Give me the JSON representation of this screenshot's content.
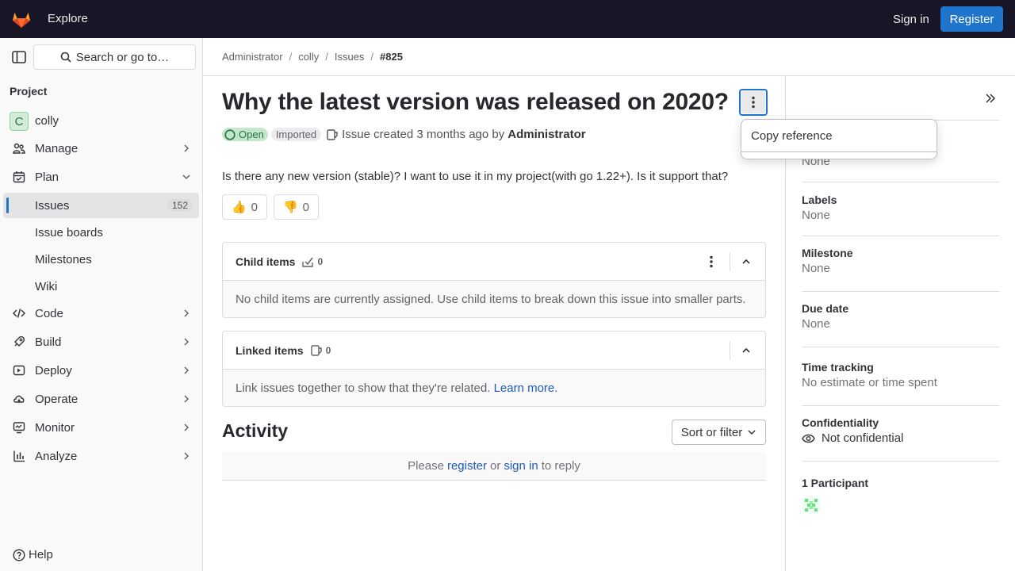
{
  "topbar": {
    "explore": "Explore",
    "sign_in": "Sign in",
    "register": "Register"
  },
  "sidebar": {
    "search": "Search or go to…",
    "section": "Project",
    "project": {
      "initial": "C",
      "name": "colly"
    },
    "items": [
      {
        "label": "Manage",
        "icon": "users-icon"
      },
      {
        "label": "Plan",
        "icon": "plan-icon"
      },
      {
        "label": "Issues",
        "count": "152"
      },
      {
        "label": "Issue boards"
      },
      {
        "label": "Milestones"
      },
      {
        "label": "Wiki"
      },
      {
        "label": "Code",
        "icon": "code-icon"
      },
      {
        "label": "Build",
        "icon": "rocket-icon"
      },
      {
        "label": "Deploy",
        "icon": "deploy-icon"
      },
      {
        "label": "Operate",
        "icon": "cloud-icon"
      },
      {
        "label": "Monitor",
        "icon": "monitor-icon"
      },
      {
        "label": "Analyze",
        "icon": "chart-icon"
      }
    ],
    "help": "Help"
  },
  "breadcrumb": [
    "Administrator",
    "colly",
    "Issues",
    "#825"
  ],
  "issue": {
    "title": "Why the latest version was released on 2020?",
    "status": "Open",
    "imported": "Imported",
    "created": "Issue created 3 months ago by",
    "author": "Administrator",
    "description": "Is there any new version (stable)? I want to use it in my project(with go 1.22+). Is it support that?",
    "thumbs_up": "0",
    "thumbs_down": "0"
  },
  "child_items": {
    "title": "Child items",
    "count": "0",
    "empty": "No child items are currently assigned. Use child items to break down this issue into smaller parts."
  },
  "linked_items": {
    "title": "Linked items",
    "count": "0",
    "text": "Link issues together to show that they're related.",
    "learn_more": "Learn more",
    "period": "."
  },
  "activity": {
    "title": "Activity",
    "sort": "Sort or filter",
    "please": "Please",
    "register": "register",
    "or": "or",
    "sign_in": "sign in",
    "to_reply": "to reply"
  },
  "right_sidebar": {
    "assignee_value": "None",
    "labels": {
      "label": "Labels",
      "value": "None"
    },
    "milestone": {
      "label": "Milestone",
      "value": "None"
    },
    "due_date": {
      "label": "Due date",
      "value": "None"
    },
    "time_tracking": {
      "label": "Time tracking",
      "value": "No estimate or time spent"
    },
    "confidentiality": {
      "label": "Confidentiality",
      "value": "Not confidential"
    },
    "participants": {
      "label": "1 Participant"
    }
  },
  "dropdown": {
    "copy_reference": "Copy reference"
  },
  "colors": {
    "accent": "#1f75cb",
    "topbar": "#181626",
    "open_green": "#217645"
  }
}
